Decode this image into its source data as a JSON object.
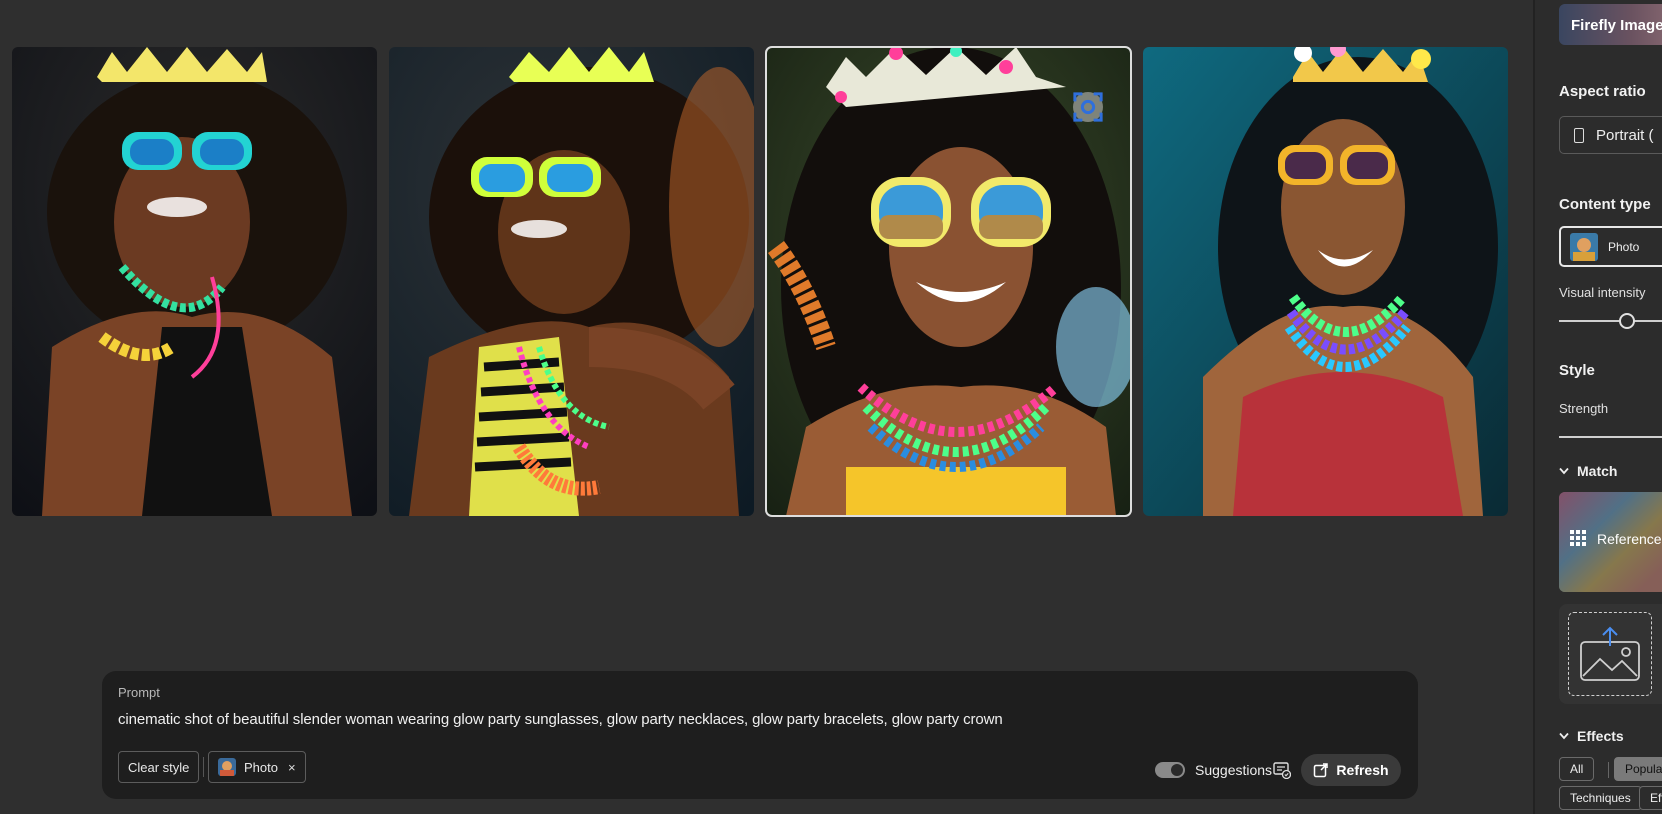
{
  "gallery": {
    "images": [
      {
        "alt": "Generated image 1",
        "selected": false
      },
      {
        "alt": "Generated image 2",
        "selected": false
      },
      {
        "alt": "Generated image 3",
        "selected": true
      },
      {
        "alt": "Generated image 4",
        "selected": false
      }
    ],
    "selected_index": 2,
    "selected_action_icon": "focus-icon"
  },
  "prompt": {
    "label": "Prompt",
    "text": "cinematic shot of beautiful slender woman wearing glow party sunglasses, glow party necklaces, glow party bracelets, glow party crown",
    "clear_style_label": "Clear style",
    "style_chip_label": "Photo",
    "style_chip_remove": "×",
    "suggestions_label": "Suggestions",
    "suggestions_on": true,
    "refresh_label": "Refresh"
  },
  "sidebar": {
    "model_label": "Firefly Image",
    "aspect_ratio_title": "Aspect ratio",
    "aspect_ratio_value": "Portrait (",
    "content_type_title": "Content type",
    "content_type_value": "Photo",
    "visual_intensity_label": "Visual intensity",
    "visual_intensity_level": 0.62,
    "style_title": "Style",
    "strength_label": "Strength",
    "match_label": "Match",
    "reference_label": "Reference",
    "effects_label": "Effects",
    "effects_tabs": [
      "All",
      "Popular",
      "Techniques",
      "Eff"
    ],
    "effects_active_tab": "Popular"
  },
  "colors": {
    "background": "#2f2f2f",
    "panel": "#1e1e1e",
    "accent_blue": "#3b82f6"
  }
}
